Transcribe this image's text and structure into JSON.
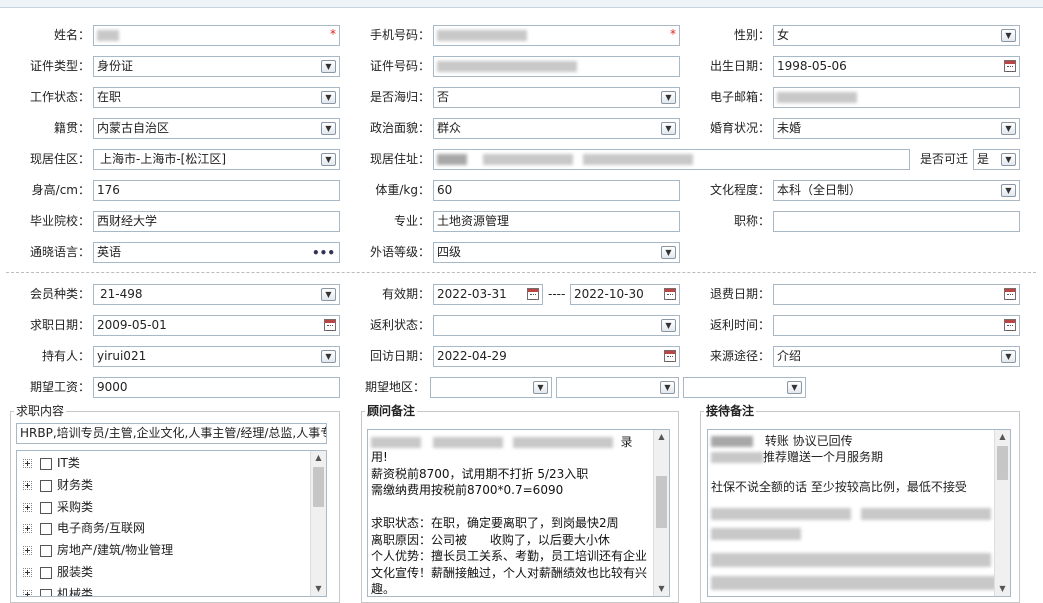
{
  "form": {
    "name_label": "姓名：",
    "phone_label": "手机号码：",
    "gender_label": "性别：",
    "gender_value": "女",
    "idtype_label": "证件类型：",
    "idtype_value": "身份证",
    "idno_label": "证件号码：",
    "birth_label": "出生日期：",
    "birth_value": "1998-05-06",
    "workstatus_label": "工作状态：",
    "workstatus_value": "在职",
    "returnee_label": "是否海归：",
    "returnee_value": "否",
    "email_label": "电子邮箱：",
    "native_label": "籍贯：",
    "native_value": "内蒙古自治区",
    "political_label": "政治面貌：",
    "political_value": "群众",
    "marital_label": "婚育状况：",
    "marital_value": "未婚",
    "curarea_label": "现居住区：",
    "curarea_value": "上海市-上海市-[松江区]",
    "curaddr_label": "现居住址：",
    "relocate_label": "是否可迁",
    "relocate_value": "是",
    "height_label": "身高/cm：",
    "height_value": "176",
    "weight_label": "体重/kg：",
    "weight_value": "60",
    "education_label": "文化程度：",
    "education_value": "本科（全日制）",
    "school_label": "毕业院校：",
    "school_value": "西财经大学",
    "major_label": "专业：",
    "major_value": "土地资源管理",
    "title_label": "职称：",
    "language_label": "通晓语言：",
    "language_value": "英语",
    "foreign_label": "外语等级：",
    "foreign_value": "四级",
    "member_label": "会员种类：",
    "member_value": "21-498",
    "valid_label": "有效期：",
    "valid_from": "2022-03-31",
    "valid_sep": "----",
    "valid_to": "2022-10-30",
    "refund_label": "退费日期：",
    "jobdate_label": "求职日期：",
    "jobdate_value": "2009-05-01",
    "rebate_label": "返利状态：",
    "rebatetime_label": "返利时间：",
    "holder_label": "持有人：",
    "holder_value": "yirui021",
    "visit_label": "回访日期：",
    "visit_value": "2022-04-29",
    "source_label": "来源途径：",
    "source_value": "介绍",
    "salary_label": "期望工资：",
    "salary_value": "9000",
    "area_label": "期望地区："
  },
  "job": {
    "title": "求职内容",
    "summary": "HRBP,培训专员/主管,企业文化,人事主管/经理/总监,人事专",
    "tree": [
      "IT类",
      "财务类",
      "采购类",
      "电子商务/互联网",
      "房地产/建筑/物业管理",
      "服装类",
      "机械类"
    ]
  },
  "advisor": {
    "title": "顾问备注",
    "line1_end": "录",
    "text": "用!\n薪资税前8700，试用期不打折 5/23入职\n需缴纳费用按税前8700*0.7=6090\n\n求职状态：在职，确定要离职了，到岗最快2周\n离职原因：公司被      收购了，以后要大小休\n个人优势：擅长员工关系、考勤，员工培训还有企业\n文化宣传！薪酬接触过，个人对薪酬绩效也比较有兴\n趣。\n推荐范围：人事岗位，人事兼行政岗位；招聘没做"
  },
  "reception": {
    "title": "接待备注",
    "line1": "转账    协议已回传",
    "line2": "推荐赠送一个月服务期",
    "line3": "社保不说全额的话 至少按较高比例，最低不接受"
  },
  "icons": {
    "dropdown": "chevron-down-icon",
    "calendar": "calendar-icon",
    "more": "ellipsis-icon",
    "expand": "plus-icon"
  },
  "colors": {
    "border": "#a9b8c7",
    "required": "#d22222",
    "header_bg": "#eef3f8"
  }
}
